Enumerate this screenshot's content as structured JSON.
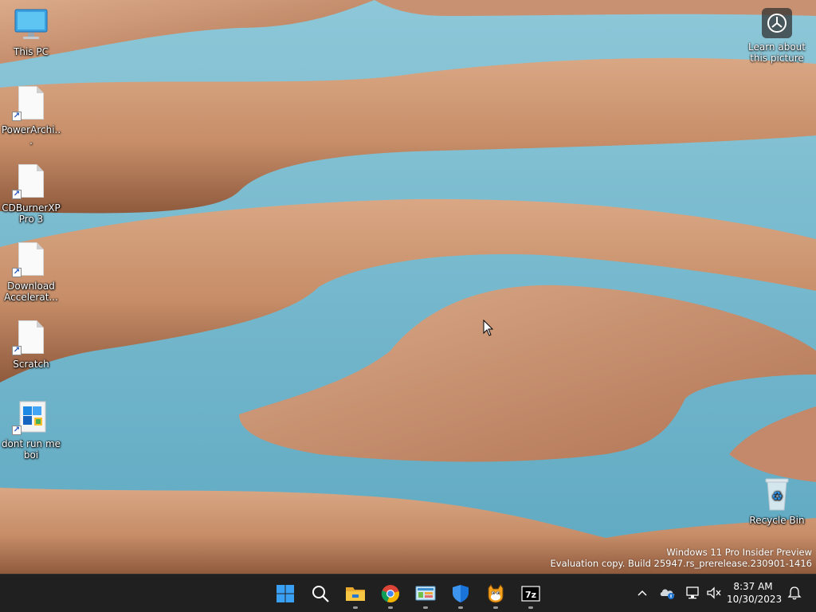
{
  "desktop": {
    "icons": [
      {
        "label": "This PC",
        "icon": "monitor-icon"
      },
      {
        "label": "PowerArchi...",
        "icon": "document-icon"
      },
      {
        "label": "CDBurnerXP Pro 3",
        "icon": "document-icon"
      },
      {
        "label": "Download Accelerat...",
        "icon": "document-icon"
      },
      {
        "label": "Scratch",
        "icon": "document-icon"
      },
      {
        "label": "dont run me boi",
        "icon": "installer-icon"
      }
    ],
    "recycle_bin": {
      "label": "Recycle Bin",
      "icon": "recycle-bin-icon"
    },
    "learn_about": {
      "label": "Learn about this picture",
      "icon": "camera-info-icon"
    },
    "watermark": {
      "line1": "Windows 11 Pro Insider Preview",
      "line2": "Evaluation copy. Build 25947.rs_prerelease.230901-1416"
    }
  },
  "taskbar": {
    "apps": [
      {
        "name": "Start",
        "icon": "windows-logo-icon",
        "running": false
      },
      {
        "name": "Search",
        "icon": "search-icon",
        "running": false
      },
      {
        "name": "File Explorer",
        "icon": "folder-icon",
        "running": true
      },
      {
        "name": "Google Chrome",
        "icon": "chrome-icon",
        "running": true
      },
      {
        "name": "Control Panel",
        "icon": "control-panel-icon",
        "running": true
      },
      {
        "name": "Windows Security",
        "icon": "shield-icon",
        "running": true
      },
      {
        "name": "Scratch",
        "icon": "scratch-cat-icon",
        "running": true
      },
      {
        "name": "7-Zip",
        "icon": "seven-zip-icon",
        "running": true
      }
    ],
    "tray": {
      "time": "8:37 AM",
      "date": "10/30/2023",
      "icons": [
        "chevron-up-icon",
        "onedrive-icon",
        "network-icon",
        "volume-muted-icon",
        "notification-bell-icon"
      ]
    },
    "colors": {
      "background": "#202020",
      "start_blue": "#0078d4"
    }
  }
}
